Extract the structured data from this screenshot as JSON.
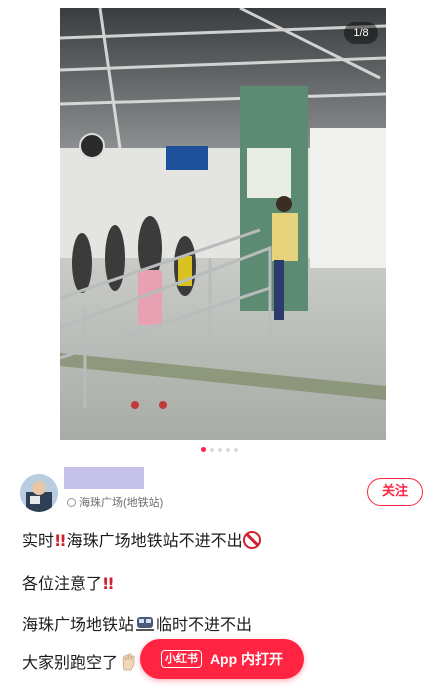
{
  "gallery": {
    "counter": "1/8",
    "total_images": 8,
    "active_index": 1
  },
  "author": {
    "location": "海珠广场(地铁站)",
    "follow_label": "关注"
  },
  "post": {
    "line1_a": "实时",
    "line1_b": "海珠广场地铁站不进不出",
    "line2": "各位注意了",
    "line3_a": "海珠广场地铁站",
    "line3_b": "临时不进不出",
    "line4": "大家别跑空了"
  },
  "cta": {
    "brand": "小红书",
    "label": "App 内打开"
  },
  "colors": {
    "accent": "#ff2442",
    "alert": "#d1202e"
  }
}
